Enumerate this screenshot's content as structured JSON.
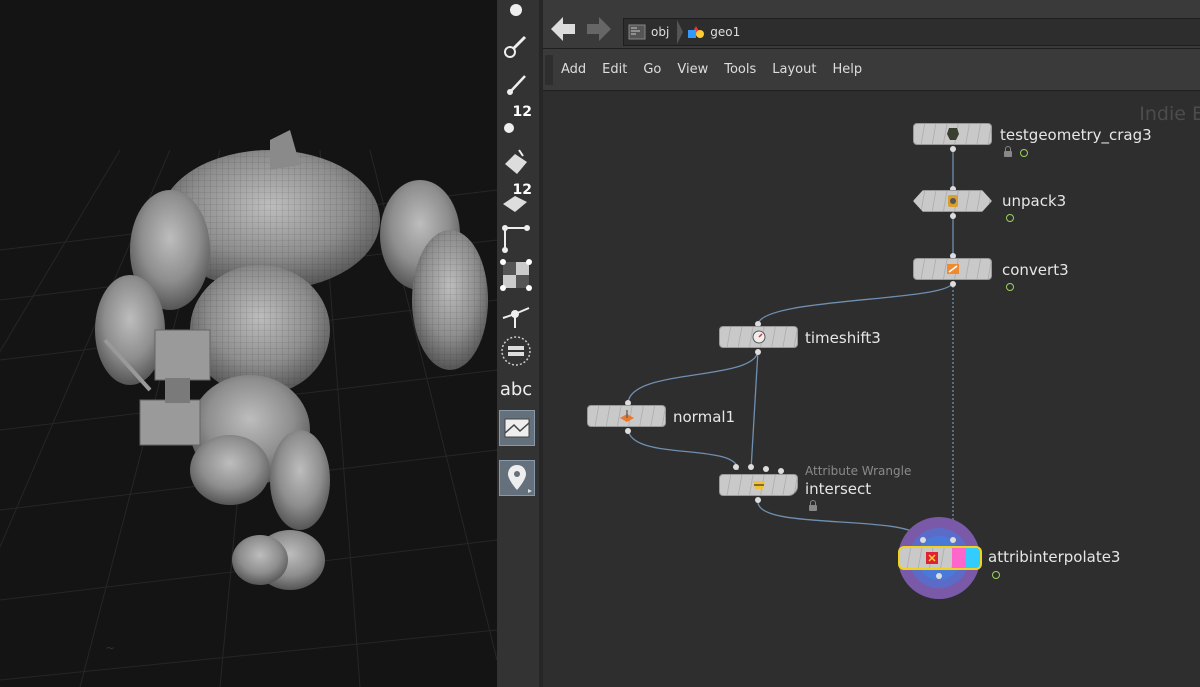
{
  "toolbar": {
    "tools": [
      {
        "name": "select-sphere-icon"
      },
      {
        "name": "brush-icon"
      },
      {
        "name": "pin-icon"
      },
      {
        "name": "point-number-icon",
        "badge": "12"
      },
      {
        "name": "primitive-icon"
      },
      {
        "name": "primitive-number-icon",
        "badge": "12"
      },
      {
        "name": "normal-icon"
      },
      {
        "name": "uv-checker-icon"
      },
      {
        "name": "point-normal-icon"
      },
      {
        "name": "quad-circle-icon"
      },
      {
        "name": "abc-text",
        "text": "abc"
      },
      {
        "name": "envelope-icon"
      },
      {
        "name": "location-pin-icon"
      }
    ]
  },
  "pathbar": {
    "crumbs": [
      {
        "label": "obj",
        "icon": "obj-network-icon"
      },
      {
        "label": "geo1",
        "icon": "geo-icon"
      }
    ]
  },
  "menu": {
    "items": [
      "Add",
      "Edit",
      "Go",
      "View",
      "Tools",
      "Layout",
      "Help"
    ]
  },
  "network": {
    "watermark": "Indie E",
    "nodes": [
      {
        "name": "testgeometry_crag3",
        "icon": "crag-figure-icon",
        "locked": true
      },
      {
        "name": "unpack3",
        "icon": "unpack-icon"
      },
      {
        "name": "convert3",
        "icon": "convert-icon"
      },
      {
        "name": "timeshift3",
        "icon": "clock-icon"
      },
      {
        "name": "normal1",
        "icon": "normal-node-icon"
      },
      {
        "name": "intersect",
        "type": "Attribute Wrangle",
        "icon": "wrangle-icon",
        "locked": true
      },
      {
        "name": "attribinterpolate3",
        "icon": "attribinterpolate-icon"
      }
    ]
  },
  "colors": {
    "wire": "#6f8fb0",
    "node_body": "#c9c9c9",
    "flag": "#9cd35a",
    "display_ring": "#7a5aa8",
    "template_bar": "#ff66cc",
    "render_bar": "#33ccff"
  }
}
